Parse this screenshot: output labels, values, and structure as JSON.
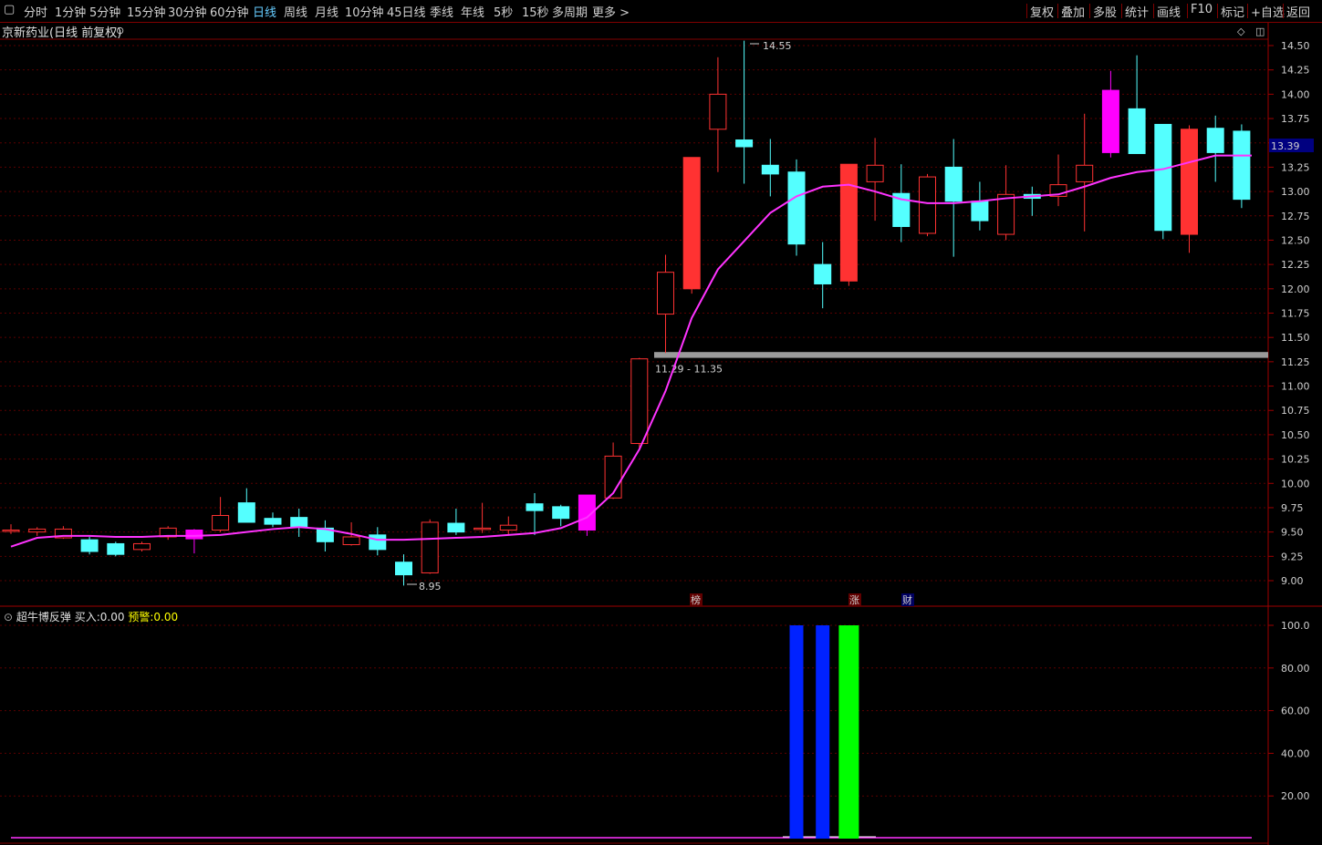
{
  "toolbar": {
    "left_items": [
      "分时",
      "1分钟",
      "5分钟",
      "15分钟",
      "30分钟",
      "60分钟",
      "日线",
      "周线",
      "月线",
      "10分钟",
      "45日线",
      "季线",
      "年线",
      "5秒",
      "15秒",
      "多周期",
      "更多 >"
    ],
    "active": "日线",
    "right_items": [
      "复权",
      "叠加",
      "多股",
      "统计",
      "画线",
      "F10",
      "标记",
      "+自选",
      "返回"
    ]
  },
  "main_chart": {
    "title": "京新药业(日线 前复权)",
    "current_price_label": "13.39",
    "annotations": {
      "high": "14.55",
      "low": "8.95",
      "range": "11.29 - 11.35"
    },
    "markers": [
      "榜",
      "涨",
      "财"
    ]
  },
  "indicator": {
    "name": "超牛博反弹",
    "buy_label": "买入:",
    "buy_value": "0.00",
    "warn_label": "预警:",
    "warn_value": "0.00"
  },
  "chart_data": [
    {
      "type": "candlestick",
      "title": "京新药业(日线 前复权)",
      "ylim": [
        8.8,
        14.7
      ],
      "yticks": [
        "14.50",
        "14.25",
        "14.00",
        "13.75",
        "13.50",
        "13.25",
        "13.00",
        "12.75",
        "12.50",
        "12.25",
        "12.00",
        "11.75",
        "11.50",
        "11.25",
        "11.00",
        "10.75",
        "10.50",
        "10.25",
        "10.00",
        "9.75",
        "9.50",
        "9.25",
        "9.00"
      ],
      "candles": [
        {
          "o": 9.52,
          "h": 9.58,
          "l": 9.48,
          "c": 9.52
        },
        {
          "o": 9.5,
          "h": 9.55,
          "l": 9.46,
          "c": 9.53
        },
        {
          "o": 9.44,
          "h": 9.56,
          "l": 9.43,
          "c": 9.53
        },
        {
          "o": 9.42,
          "h": 9.45,
          "l": 9.27,
          "c": 9.3
        },
        {
          "o": 9.38,
          "h": 9.4,
          "l": 9.25,
          "c": 9.27
        },
        {
          "o": 9.32,
          "h": 9.4,
          "l": 9.3,
          "c": 9.38
        },
        {
          "o": 9.45,
          "h": 9.56,
          "l": 9.42,
          "c": 9.54
        },
        {
          "o": 9.43,
          "h": 9.53,
          "l": 9.28,
          "c": 9.52
        },
        {
          "o": 9.52,
          "h": 9.86,
          "l": 9.5,
          "c": 9.67
        },
        {
          "o": 9.8,
          "h": 9.95,
          "l": 9.63,
          "c": 9.6
        },
        {
          "o": 9.64,
          "h": 9.7,
          "l": 9.55,
          "c": 9.58
        },
        {
          "o": 9.65,
          "h": 9.74,
          "l": 9.45,
          "c": 9.55
        },
        {
          "o": 9.54,
          "h": 9.62,
          "l": 9.3,
          "c": 9.4
        },
        {
          "o": 9.37,
          "h": 9.6,
          "l": 9.36,
          "c": 9.45
        },
        {
          "o": 9.47,
          "h": 9.55,
          "l": 9.26,
          "c": 9.32
        },
        {
          "o": 9.19,
          "h": 9.27,
          "l": 8.95,
          "c": 9.06
        },
        {
          "o": 9.08,
          "h": 9.63,
          "l": 9.07,
          "c": 9.6
        },
        {
          "o": 9.59,
          "h": 9.74,
          "l": 9.47,
          "c": 9.5
        },
        {
          "o": 9.53,
          "h": 9.8,
          "l": 9.49,
          "c": 9.54
        },
        {
          "o": 9.52,
          "h": 9.66,
          "l": 9.47,
          "c": 9.57
        },
        {
          "o": 9.79,
          "h": 9.9,
          "l": 9.47,
          "c": 9.72
        },
        {
          "o": 9.76,
          "h": 9.78,
          "l": 9.56,
          "c": 9.64
        },
        {
          "o": 9.52,
          "h": 9.88,
          "l": 9.46,
          "c": 9.88
        },
        {
          "o": 9.85,
          "h": 10.42,
          "l": 9.84,
          "c": 10.28
        },
        {
          "o": 10.41,
          "h": 11.29,
          "l": 10.34,
          "c": 11.28
        },
        {
          "o": 11.74,
          "h": 12.35,
          "l": 11.34,
          "c": 12.17
        },
        {
          "o": 12.0,
          "h": 13.35,
          "l": 11.95,
          "c": 13.35
        },
        {
          "o": 13.64,
          "h": 14.38,
          "l": 13.2,
          "c": 14.0
        },
        {
          "o": 13.53,
          "h": 14.55,
          "l": 13.08,
          "c": 13.46
        },
        {
          "o": 13.27,
          "h": 13.54,
          "l": 12.95,
          "c": 13.18
        },
        {
          "o": 13.2,
          "h": 13.33,
          "l": 12.34,
          "c": 12.46
        },
        {
          "o": 12.25,
          "h": 12.48,
          "l": 11.8,
          "c": 12.05
        },
        {
          "o": 12.08,
          "h": 13.28,
          "l": 12.03,
          "c": 13.28
        },
        {
          "o": 13.1,
          "h": 13.55,
          "l": 12.7,
          "c": 13.27
        },
        {
          "o": 12.98,
          "h": 13.28,
          "l": 12.48,
          "c": 12.64
        },
        {
          "o": 12.57,
          "h": 13.18,
          "l": 12.54,
          "c": 13.15
        },
        {
          "o": 13.25,
          "h": 13.54,
          "l": 12.33,
          "c": 12.9
        },
        {
          "o": 12.9,
          "h": 13.1,
          "l": 12.6,
          "c": 12.7
        },
        {
          "o": 12.56,
          "h": 13.27,
          "l": 12.5,
          "c": 12.97
        },
        {
          "o": 12.97,
          "h": 13.05,
          "l": 12.75,
          "c": 12.93
        },
        {
          "o": 12.95,
          "h": 13.38,
          "l": 12.85,
          "c": 13.07
        },
        {
          "o": 13.1,
          "h": 13.8,
          "l": 12.59,
          "c": 13.27
        },
        {
          "o": 13.4,
          "h": 14.24,
          "l": 13.35,
          "c": 14.04
        },
        {
          "o": 13.85,
          "h": 14.4,
          "l": 13.4,
          "c": 13.39
        },
        {
          "o": 13.69,
          "h": 13.69,
          "l": 12.51,
          "c": 12.6
        },
        {
          "o": 12.56,
          "h": 13.68,
          "l": 12.37,
          "c": 13.64
        },
        {
          "o": 13.65,
          "h": 13.78,
          "l": 13.1,
          "c": 13.4
        },
        {
          "o": 13.62,
          "h": 13.69,
          "l": 12.83,
          "c": 12.92
        }
      ],
      "magenta_bodies": [
        7,
        22,
        42
      ],
      "ma_line": [
        9.35,
        9.44,
        9.46,
        9.46,
        9.45,
        9.45,
        9.46,
        9.46,
        9.47,
        9.5,
        9.53,
        9.55,
        9.53,
        9.48,
        9.42,
        9.42,
        9.43,
        9.44,
        9.45,
        9.47,
        9.49,
        9.54,
        9.65,
        9.9,
        10.35,
        10.95,
        11.7,
        12.2,
        12.49,
        12.78,
        12.95,
        13.05,
        13.07,
        13.0,
        12.92,
        12.88,
        12.88,
        12.9,
        12.93,
        12.95,
        12.97,
        13.05,
        13.14,
        13.2,
        13.23,
        13.3,
        13.37,
        13.37
      ],
      "support_band": [
        11.29,
        11.35
      ]
    },
    {
      "type": "bar",
      "title": "超牛博反弹",
      "ylim": [
        0,
        100
      ],
      "yticks": [
        "100.0",
        "80.00",
        "60.00",
        "40.00",
        "20.00"
      ],
      "bars": [
        {
          "index": 30,
          "value": 100,
          "color": "#0022ff"
        },
        {
          "index": 31,
          "value": 100,
          "color": "#0022ff"
        },
        {
          "index": 32,
          "value": 100,
          "color": "#00ff00"
        }
      ]
    }
  ]
}
